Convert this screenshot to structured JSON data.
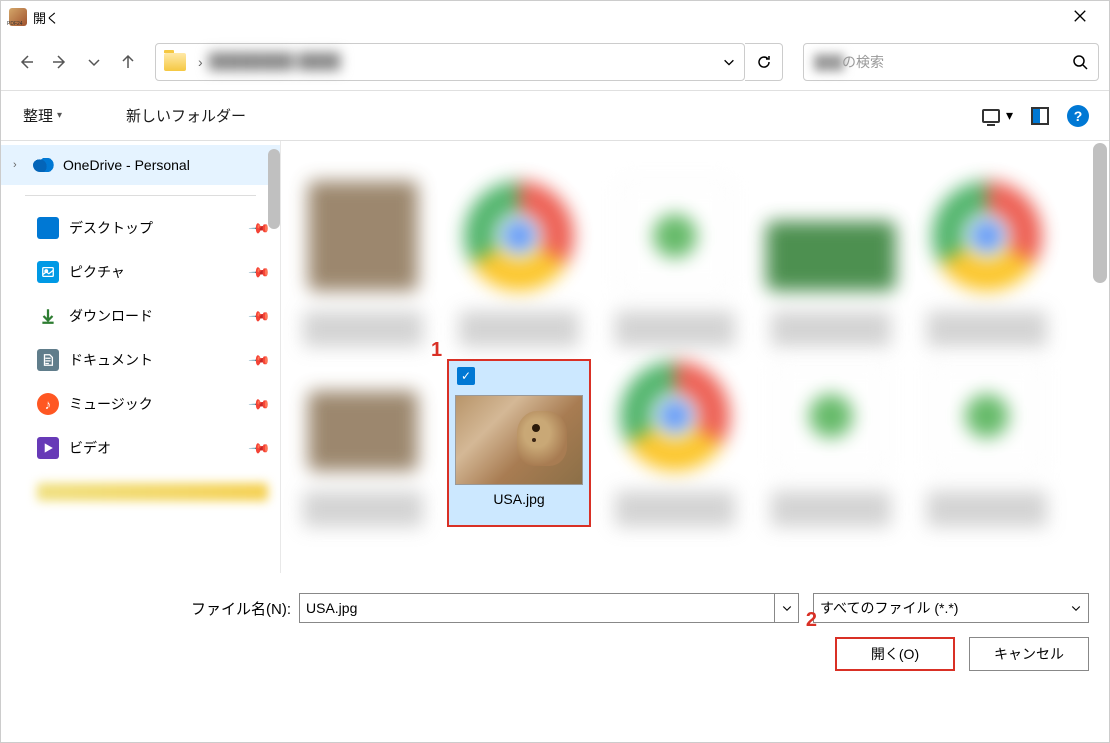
{
  "title": "開く",
  "nav": {
    "blurred_path_hint": "████████ ████",
    "search_blurred": "███",
    "search_suffix": "の検索"
  },
  "toolbar": {
    "organize": "整理",
    "new_folder": "新しいフォルダー"
  },
  "sidebar": {
    "onedrive": "OneDrive - Personal",
    "quick": [
      "デスクトップ",
      "ピクチャ",
      "ダウンロード",
      "ドキュメント",
      "ミュージック",
      "ビデオ"
    ]
  },
  "selected_file": {
    "name": "USA.jpg"
  },
  "annotations": {
    "one": "1",
    "two": "2"
  },
  "bottom": {
    "filename_label": "ファイル名(N):",
    "filename_value": "USA.jpg",
    "filetype": "すべてのファイル (*.*)",
    "open_btn": "開く(O)",
    "cancel_btn": "キャンセル"
  }
}
